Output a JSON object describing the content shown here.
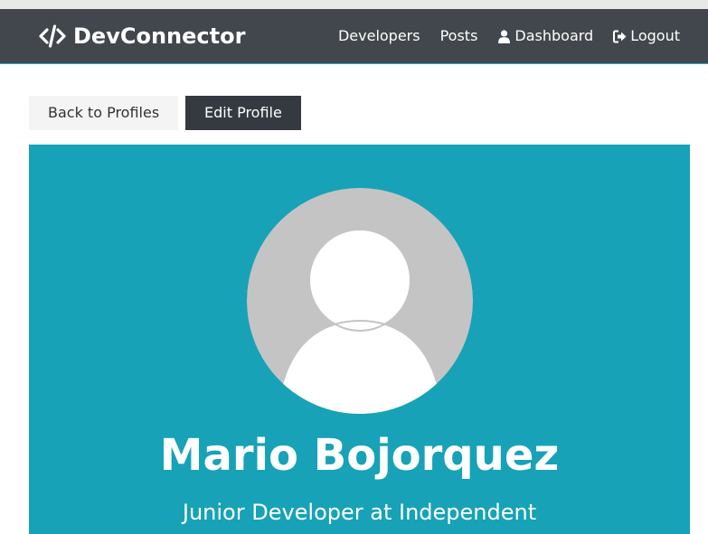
{
  "navbar": {
    "brand": "DevConnector",
    "brand_icon": "code-icon",
    "links": [
      {
        "label": "Developers"
      },
      {
        "label": "Posts"
      },
      {
        "label": "Dashboard",
        "icon": "user-icon"
      },
      {
        "label": "Logout",
        "icon": "sign-out-icon"
      }
    ]
  },
  "actions": {
    "back": "Back to Profiles",
    "edit": "Edit Profile"
  },
  "profile": {
    "avatar_icon": "default-avatar-icon",
    "name": "Mario Bojorquez",
    "status": "Junior Developer at Independent"
  },
  "colors": {
    "navbar": "#343a40",
    "primary": "#17a2b8",
    "light": "#f4f4f4",
    "dark": "#343a40"
  }
}
